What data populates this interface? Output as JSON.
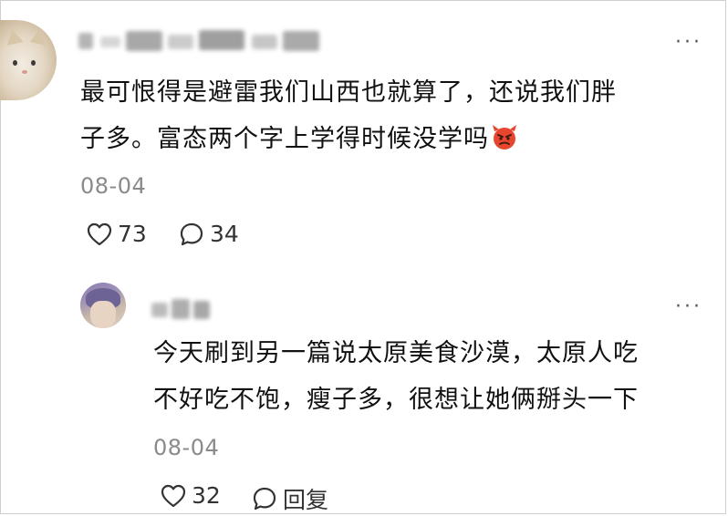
{
  "comment": {
    "text_line1": "最可恨得是避雷我们山西也就算了，还说我们胖",
    "text_line2": "子多。富态两个字上学得时候没学吗",
    "emoji_icon": "angry-devil-emoji",
    "date": "08-04",
    "likes": "73",
    "replies": "34"
  },
  "reply": {
    "text_line1": "今天刷到另一篇说太原美食沙漠，太原人吃",
    "text_line2": "不好吃不饱，瘦子多，很想让她俩掰头一下",
    "date": "08-04",
    "likes": "32",
    "reply_label": "回复"
  },
  "colors": {
    "text": "#111111",
    "meta": "#8a8a8a",
    "icon": "#333333"
  }
}
